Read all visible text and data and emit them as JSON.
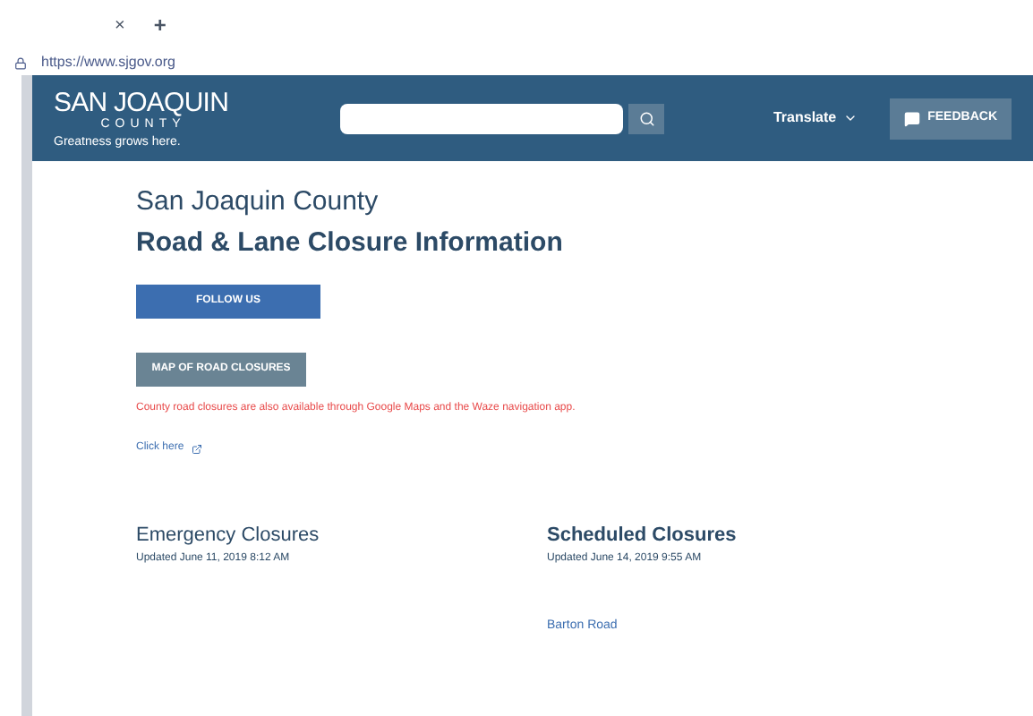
{
  "browser": {
    "tab_close": "×",
    "new_tab": "+",
    "url": "https://www.sjgov.org"
  },
  "header": {
    "logo": {
      "line_1": "SAN JOAQUIN",
      "line_2": "COUNTY",
      "tagline": "Greatness grows here."
    },
    "translate": "Translate",
    "feedback": "FEEDBACK"
  },
  "page": {
    "kicker": "San Joaquin County",
    "title": "Road & Lane Closure Information",
    "follow": "FOLLOW US",
    "map": "MAP OF ROAD CLOSURES",
    "notice": "County road closures are also available through Google Maps and the Waze navigation app.",
    "link": "Click here"
  },
  "emergency": {
    "title": "Emergency Closures",
    "updated": "Updated June 11, 2019 8:12 AM"
  },
  "scheduled": {
    "title": "Scheduled Closures",
    "updated": "Updated June 14, 2019 9:55 AM",
    "items": [
      {
        "name": "Barton Road"
      }
    ]
  }
}
